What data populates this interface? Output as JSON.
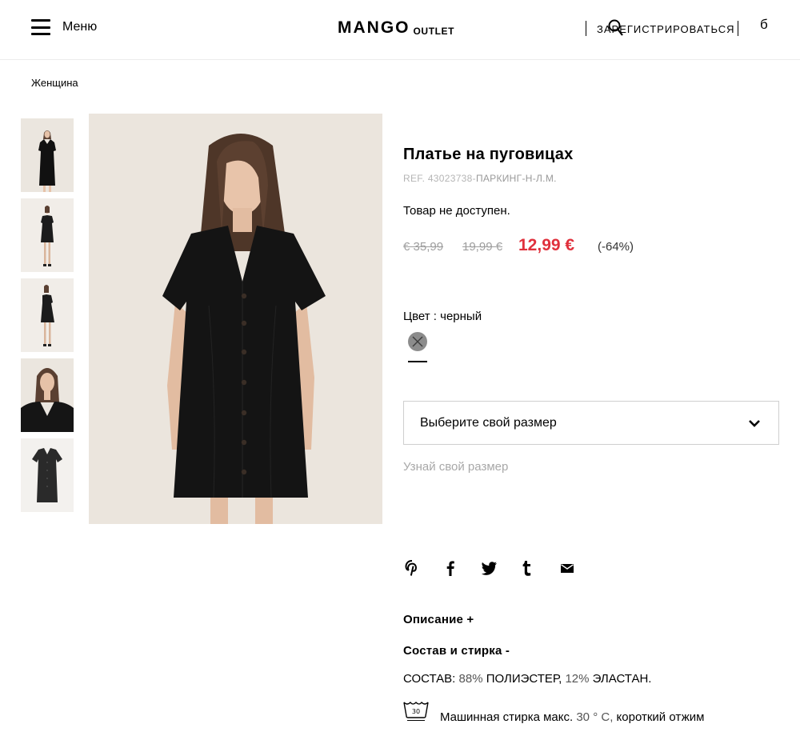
{
  "header": {
    "menu_label": "Меню",
    "logo_main": "MANGO",
    "logo_sub": "OUTLET",
    "register_label": "ЗАРЕГИСТРИРОВАТЬСЯ",
    "cart_label": "б"
  },
  "breadcrumb": {
    "label": "Женщина"
  },
  "gallery": {
    "thumbnails": [
      "front",
      "full-front",
      "full-side",
      "close-up",
      "flat-lay"
    ]
  },
  "product": {
    "title": "Платье на пуговицах",
    "ref_prefix": "REF. 43023738-",
    "ref_suffix": "ПАРКИНГ-Н-Л.М.",
    "availability": "Товар не доступен.",
    "price_original": "€ 35,99",
    "price_previous": "19,99 €",
    "price_current": "12,99 €",
    "discount": "(-64%)",
    "color_label": "Цвет :",
    "color_value": "черный",
    "size_placeholder": "Выберите свой размер",
    "size_guide": "Узнай свой размер"
  },
  "share": [
    "pinterest",
    "facebook",
    "twitter",
    "tumblr",
    "email"
  ],
  "sections": {
    "description": "Описание +",
    "composition_title": "Состав и стирка -",
    "composition_label": "СОСТАВ:",
    "composition_pct1": "88%",
    "composition_mat1": "ПОЛИЭСТЕР,",
    "composition_pct2": "12%",
    "composition_mat2": "ЭЛАСТАН.",
    "wash_icon_text": "30",
    "wash_text_a": "Машинная стирка макс.",
    "wash_text_b": "30 ° C,",
    "wash_text_c": "короткий отжим"
  },
  "colors": {
    "price_sale": "#e0303c",
    "muted": "#a8a8a8",
    "photo_bg": "#ebe5dd"
  }
}
